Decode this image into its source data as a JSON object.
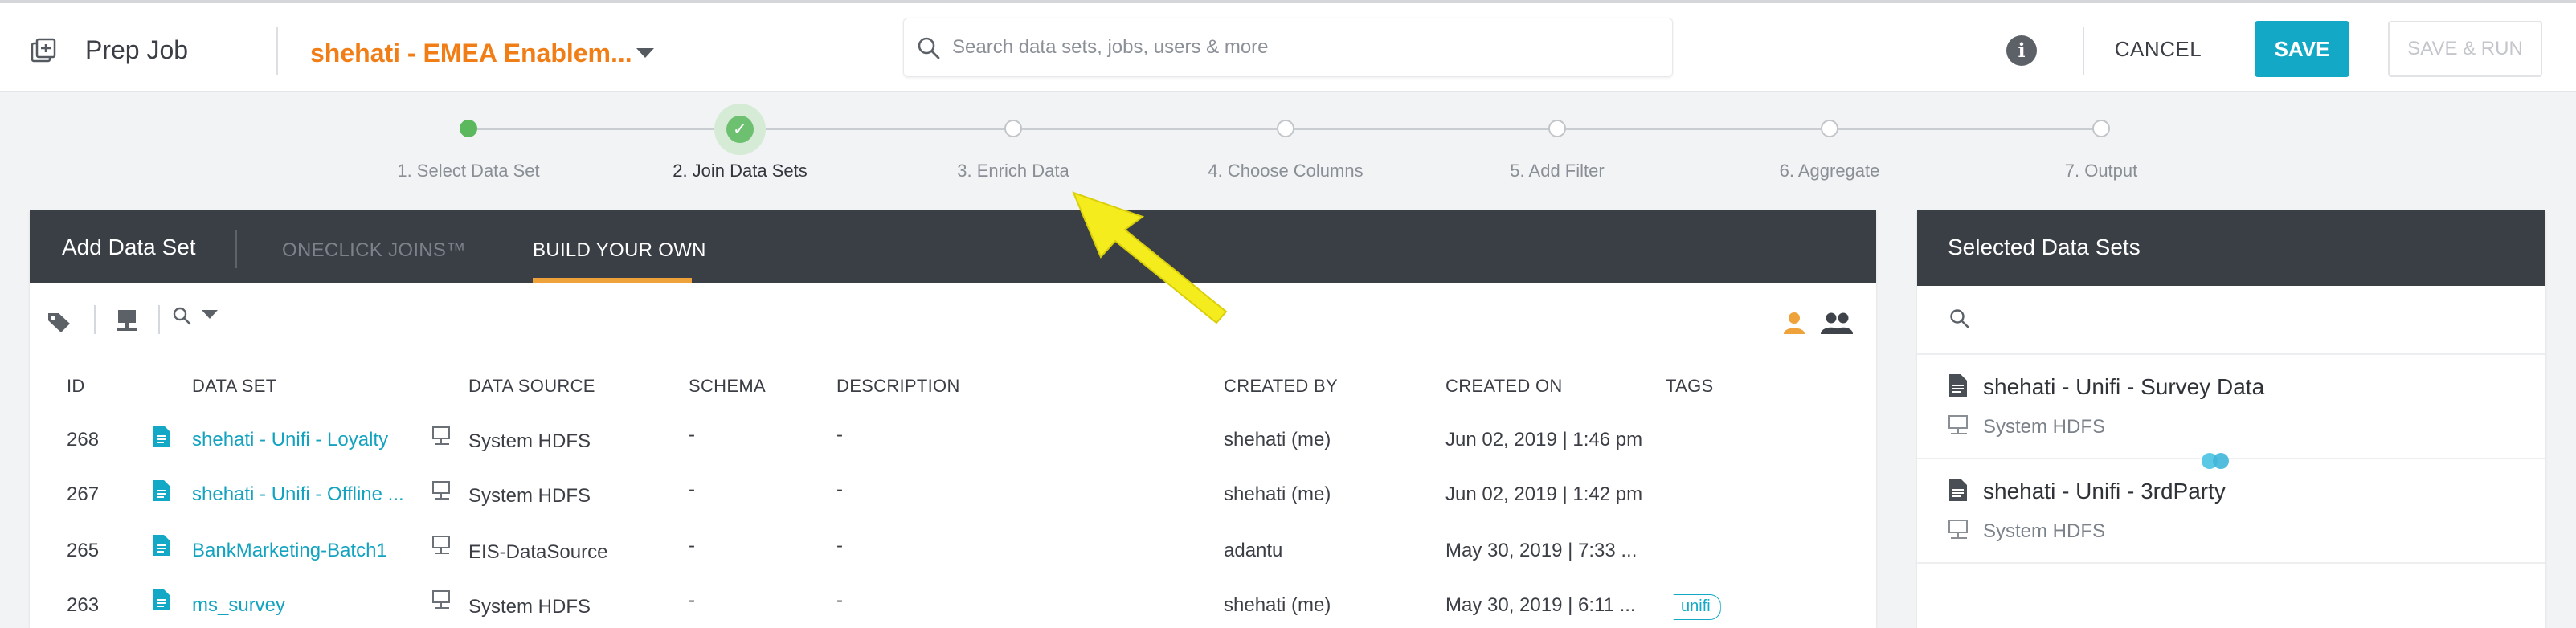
{
  "topbar": {
    "title": "Prep Job",
    "job_name": "shehati - EMEA Enablem...",
    "search_placeholder": "Search data sets, jobs, users & more",
    "info_glyph": "i",
    "cancel_label": "CANCEL",
    "save_label": "SAVE",
    "save_run_label": "SAVE & RUN"
  },
  "stepper": {
    "steps": [
      {
        "label": "1. Select Data Set",
        "state": "done"
      },
      {
        "label": "2. Join Data Sets",
        "state": "current"
      },
      {
        "label": "3. Enrich Data",
        "state": "pending"
      },
      {
        "label": "4. Choose Columns",
        "state": "pending"
      },
      {
        "label": "5. Add Filter",
        "state": "pending"
      },
      {
        "label": "6. Aggregate",
        "state": "pending"
      },
      {
        "label": "7. Output",
        "state": "pending"
      }
    ],
    "check_glyph": "✓"
  },
  "add_data_set": {
    "title": "Add Data Set",
    "tab_oneclick": "ONECLICK JOINS™",
    "tab_build": "BUILD YOUR OWN",
    "columns": {
      "id": "ID",
      "data_set": "DATA SET",
      "data_source": "DATA SOURCE",
      "schema": "SCHEMA",
      "description": "DESCRIPTION",
      "created_by": "CREATED BY",
      "created_on": "CREATED ON",
      "tags": "TAGS"
    },
    "rows": [
      {
        "id": "268",
        "data_set": "shehati - Unifi - Loyalty",
        "data_source": "System HDFS",
        "schema": "-",
        "description": "-",
        "created_by": "shehati (me)",
        "created_on": "Jun 02, 2019 | 1:46 pm",
        "tag": ""
      },
      {
        "id": "267",
        "data_set": "shehati - Unifi - Offline ...",
        "data_source": "System HDFS",
        "schema": "-",
        "description": "-",
        "created_by": "shehati (me)",
        "created_on": "Jun 02, 2019 | 1:42 pm",
        "tag": ""
      },
      {
        "id": "265",
        "data_set": "BankMarketing-Batch1",
        "data_source": "EIS-DataSource",
        "schema": "-",
        "description": "-",
        "created_by": "adantu",
        "created_on": "May 30, 2019 | 7:33 ...",
        "tag": ""
      },
      {
        "id": "263",
        "data_set": "ms_survey",
        "data_source": "System HDFS",
        "schema": "-",
        "description": "-",
        "created_by": "shehati (me)",
        "created_on": "May 30, 2019 | 6:11 ...",
        "tag": "unifi"
      }
    ]
  },
  "selected_data_sets": {
    "title": "Selected Data Sets",
    "items": [
      {
        "name": "shehati - Unifi - Survey Data",
        "source": "System HDFS"
      },
      {
        "name": "shehati - Unifi - 3rdParty",
        "source": "System HDFS"
      }
    ]
  },
  "colors": {
    "accent": "#13a8c6",
    "brand_orange": "#f07d16",
    "header_dark": "#3a3f46",
    "success": "#5cb85c",
    "annotation_arrow": "#f5ec1e"
  }
}
